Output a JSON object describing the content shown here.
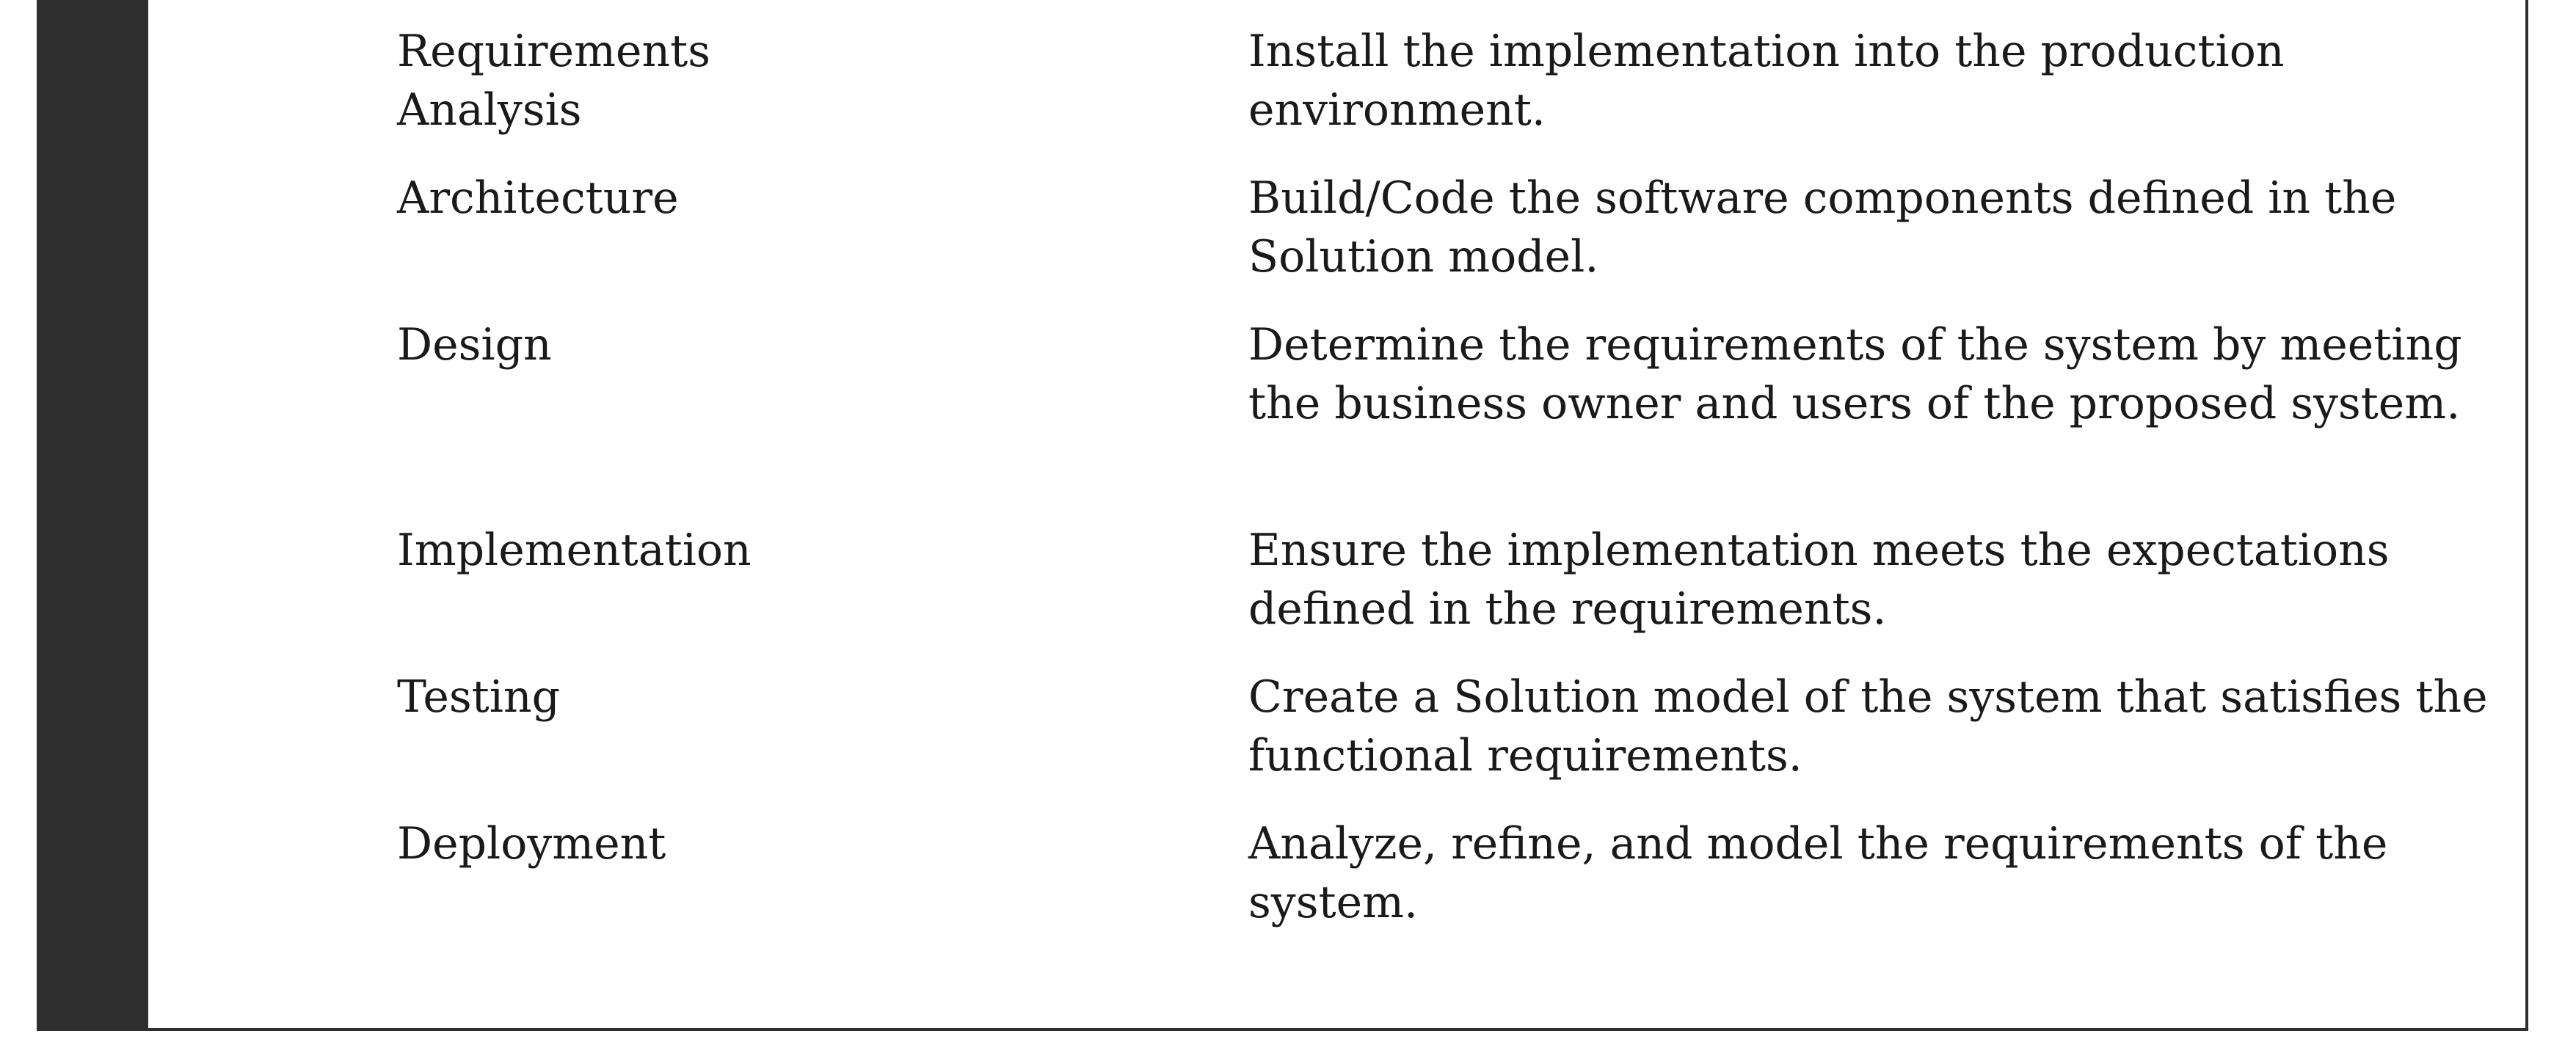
{
  "rows": [
    {
      "term": "Requirements\nAnalysis",
      "description": "Install the implementation into the production environment."
    },
    {
      "term": "Architecture",
      "description": "Build/Code the software components defined in the Solution model."
    },
    {
      "term": "Design",
      "description": "Determine the requirements of the system by meeting the business owner and users of the proposed system."
    },
    {
      "term": "Implementation",
      "description": "Ensure the implementation meets the expectations defined in the requirements."
    },
    {
      "term": "Testing",
      "description": "Create a Solution model of the system that satisfies the functional requirements."
    },
    {
      "term": "Deployment",
      "description": "Analyze, refine, and model the requirements of the system."
    }
  ]
}
